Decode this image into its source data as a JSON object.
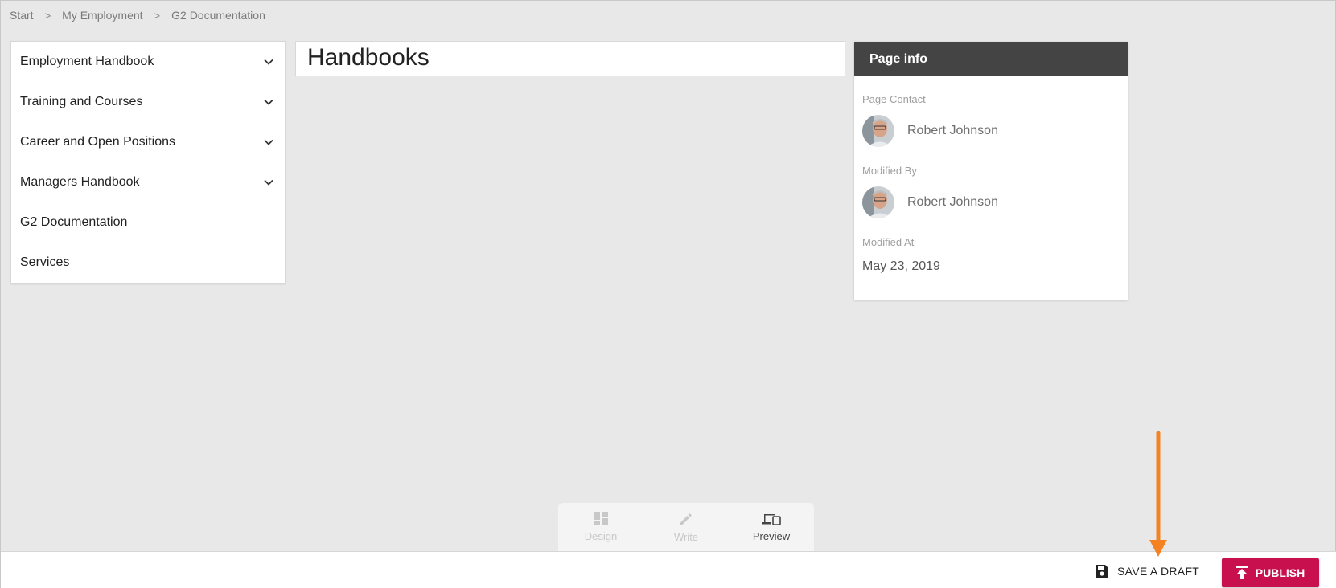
{
  "breadcrumb": {
    "items": [
      "Start",
      "My Employment",
      "G2 Documentation"
    ],
    "separator": ">"
  },
  "sidebar": {
    "items": [
      {
        "label": "Employment Handbook",
        "expandable": true
      },
      {
        "label": "Training and Courses",
        "expandable": true
      },
      {
        "label": "Career and Open Positions",
        "expandable": true
      },
      {
        "label": "Managers Handbook",
        "expandable": true
      },
      {
        "label": "G2 Documentation",
        "expandable": false
      },
      {
        "label": "Services",
        "expandable": false
      }
    ]
  },
  "page": {
    "title": "Handbooks"
  },
  "page_info": {
    "header": "Page info",
    "contact_label": "Page Contact",
    "contact_name": "Robert Johnson",
    "modified_by_label": "Modified By",
    "modified_by_name": "Robert Johnson",
    "modified_at_label": "Modified At",
    "modified_at": "May 23, 2019"
  },
  "mode_switch": {
    "modes": [
      {
        "label": "Design",
        "icon": "dashboard-icon",
        "state": "disabled"
      },
      {
        "label": "Write",
        "icon": "pencil-icon",
        "state": "disabled"
      },
      {
        "label": "Preview",
        "icon": "devices-icon",
        "state": "active"
      }
    ]
  },
  "footer": {
    "save_draft_label": "SAVE A DRAFT",
    "publish_label": "PUBLISH"
  },
  "colors": {
    "accent": "#c8104f",
    "annotation": "#f58220",
    "header_bg": "#444444",
    "page_bg": "#e8e8e8"
  }
}
